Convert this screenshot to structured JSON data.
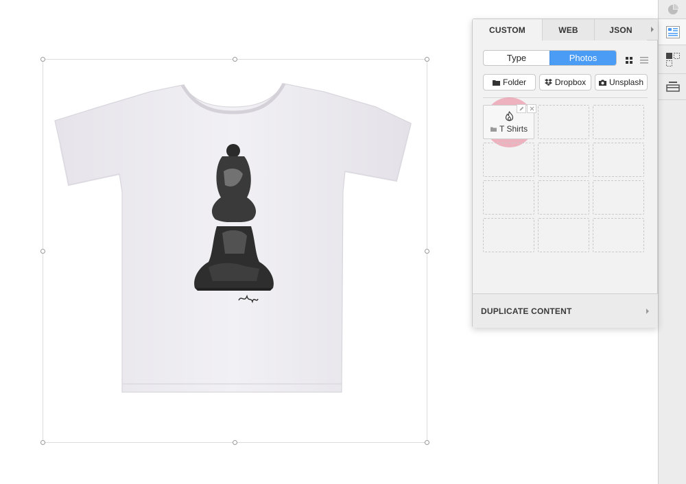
{
  "panel": {
    "tabs": [
      {
        "label": "CUSTOM",
        "active": true
      },
      {
        "label": "WEB",
        "active": false
      },
      {
        "label": "JSON",
        "active": false
      }
    ],
    "segment": {
      "options": [
        "Type",
        "Photos"
      ],
      "selected": "Photos"
    },
    "sources": {
      "folder": "Folder",
      "dropbox": "Dropbox",
      "unsplash": "Unsplash"
    },
    "items": [
      {
        "label": "T Shirts",
        "icon": "flame-icon"
      }
    ],
    "empty_slots": 11,
    "footer_label": "DUPLICATE CONTENT"
  },
  "colors": {
    "accent": "#4a9cf5",
    "highlight": "#e85a78"
  },
  "canvas": {
    "image": "t-shirt with chess pawn portrait print"
  }
}
